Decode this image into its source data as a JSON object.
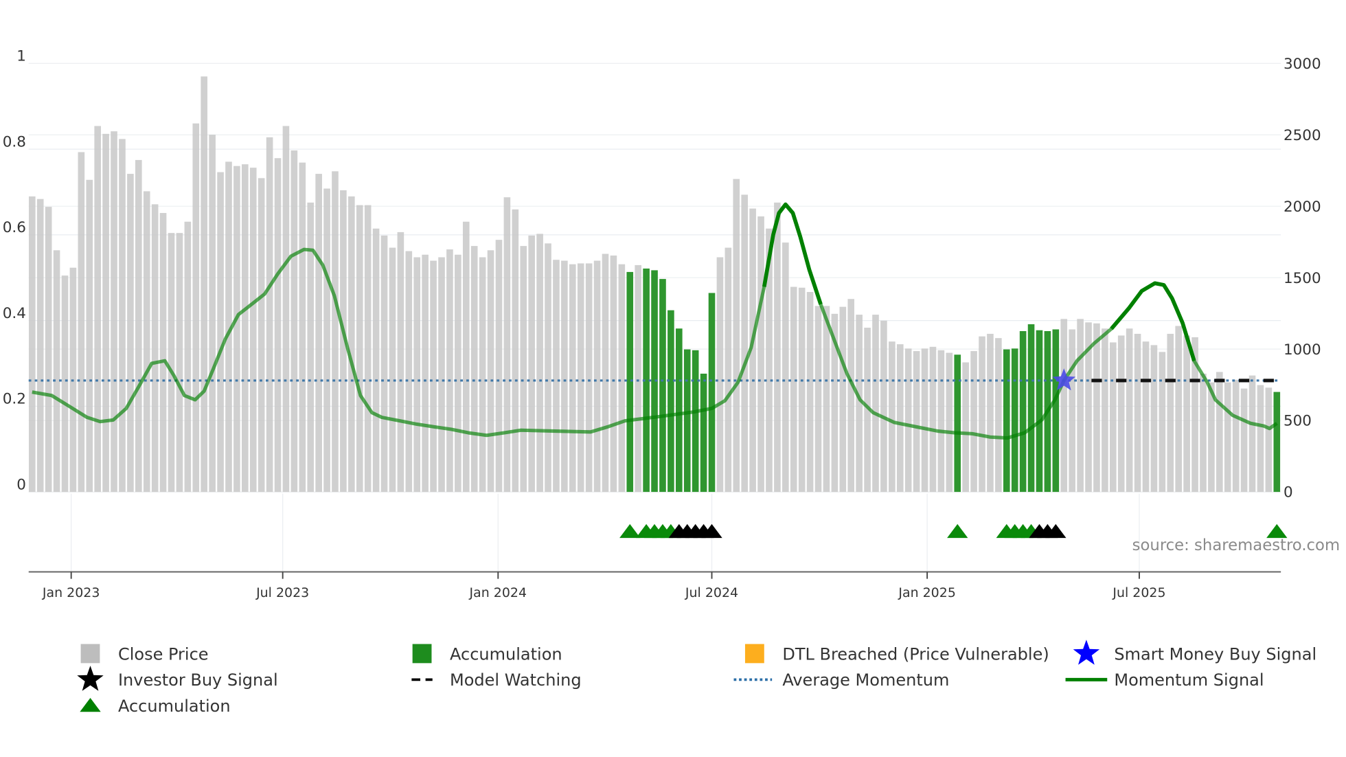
{
  "chart_data": {
    "type": "bar",
    "title": "",
    "x_unit": "week index",
    "x_ticks": [
      {
        "label": "Jan 2023",
        "at": 4.77
      },
      {
        "label": "Jul 2023",
        "at": 30.6
      },
      {
        "label": "Jan 2024",
        "at": 56.9
      },
      {
        "label": "Jul 2024",
        "at": 83.0
      },
      {
        "label": "Jan 2025",
        "at": 109.3
      },
      {
        "label": "Jul 2025",
        "at": 135.2
      }
    ],
    "left_axis": {
      "ylim": [
        0,
        1
      ],
      "ticks": [
        "0",
        "0.2",
        "0.4",
        "0.6",
        "0.8",
        "1"
      ],
      "tick_values": [
        0,
        0.2,
        0.4,
        0.6,
        0.8,
        1
      ]
    },
    "right_axis": {
      "ylim": [
        0,
        3000
      ],
      "ticks": [
        "0",
        "500",
        "1000",
        "1500",
        "2000",
        "2500",
        "3000"
      ],
      "tick_values": [
        0,
        500,
        1000,
        1500,
        2000,
        2500,
        3000
      ]
    },
    "close_price": [
      2069,
      2051,
      1996,
      1692,
      1515,
      1570,
      2379,
      2185,
      2562,
      2507,
      2525,
      2471,
      2227,
      2324,
      2105,
      2014,
      1953,
      1813,
      1813,
      1892,
      2580,
      2909,
      2501,
      2239,
      2312,
      2282,
      2294,
      2270,
      2197,
      2483,
      2337,
      2562,
      2391,
      2306,
      2026,
      2227,
      2124,
      2245,
      2112,
      2069,
      2008,
      2008,
      1844,
      1795,
      1710,
      1819,
      1686,
      1643,
      1661,
      1619,
      1643,
      1698,
      1661,
      1892,
      1722,
      1643,
      1692,
      1765,
      2063,
      1978,
      1722,
      1795,
      1807,
      1740,
      1625,
      1619,
      1594,
      1600,
      1600,
      1619,
      1667,
      1655,
      1594,
      1540,
      1588,
      1564,
      1552,
      1491,
      1272,
      1144,
      998,
      992,
      828,
      1393,
      1643,
      1710,
      2191,
      2081,
      1984,
      1929,
      1844,
      2026,
      1746,
      1436,
      1430,
      1400,
      1302,
      1302,
      1247,
      1296,
      1351,
      1241,
      1150,
      1241,
      1199,
      1053,
      1034,
      1004,
      986,
      1004,
      1016,
      992,
      974,
      961,
      907,
      986,
      1089,
      1107,
      1077,
      998,
      1004,
      1126,
      1174,
      1132,
      1126,
      1138,
      1211,
      1138,
      1211,
      1187,
      1180,
      1144,
      1047,
      1095,
      1144,
      1107,
      1053,
      1028,
      980,
      1107,
      1162,
      1095,
      1083,
      828,
      767,
      840,
      767,
      785,
      724,
      815,
      748,
      730,
      700
    ],
    "accumulation_bar_indices": [
      73,
      75,
      76,
      77,
      78,
      79,
      80,
      81,
      82,
      83,
      113,
      119,
      120,
      121,
      122,
      123,
      124,
      125,
      152
    ],
    "momentum_signal": [
      [
        0,
        0.233
      ],
      [
        2.4,
        0.225
      ],
      [
        4.6,
        0.199
      ],
      [
        6.7,
        0.174
      ],
      [
        8.3,
        0.164
      ],
      [
        9.9,
        0.168
      ],
      [
        11.5,
        0.195
      ],
      [
        13,
        0.245
      ],
      [
        14.6,
        0.3
      ],
      [
        16.2,
        0.306
      ],
      [
        17.3,
        0.272
      ],
      [
        18.6,
        0.225
      ],
      [
        19.9,
        0.215
      ],
      [
        21,
        0.235
      ],
      [
        22.1,
        0.286
      ],
      [
        23.6,
        0.357
      ],
      [
        25.2,
        0.414
      ],
      [
        26.8,
        0.438
      ],
      [
        28.4,
        0.462
      ],
      [
        30,
        0.509
      ],
      [
        31.6,
        0.55
      ],
      [
        33.2,
        0.566
      ],
      [
        34.3,
        0.564
      ],
      [
        35.5,
        0.529
      ],
      [
        36.9,
        0.458
      ],
      [
        38.5,
        0.337
      ],
      [
        40.1,
        0.225
      ],
      [
        41.5,
        0.185
      ],
      [
        42.7,
        0.174
      ],
      [
        44.9,
        0.166
      ],
      [
        47,
        0.158
      ],
      [
        49.1,
        0.152
      ],
      [
        51.2,
        0.146
      ],
      [
        53.3,
        0.138
      ],
      [
        55.5,
        0.132
      ],
      [
        57.6,
        0.138
      ],
      [
        59.7,
        0.144
      ],
      [
        63.9,
        0.142
      ],
      [
        68.2,
        0.14
      ],
      [
        70.3,
        0.152
      ],
      [
        72.4,
        0.166
      ],
      [
        76.7,
        0.176
      ],
      [
        80.9,
        0.187
      ],
      [
        83,
        0.195
      ],
      [
        84.6,
        0.213
      ],
      [
        86.2,
        0.256
      ],
      [
        87.8,
        0.337
      ],
      [
        89.4,
        0.479
      ],
      [
        90.5,
        0.6
      ],
      [
        91.2,
        0.651
      ],
      [
        92,
        0.671
      ],
      [
        92.9,
        0.651
      ],
      [
        93.8,
        0.596
      ],
      [
        94.9,
        0.519
      ],
      [
        96.3,
        0.438
      ],
      [
        97.9,
        0.357
      ],
      [
        99.5,
        0.276
      ],
      [
        101.1,
        0.215
      ],
      [
        102.7,
        0.185
      ],
      [
        105.3,
        0.162
      ],
      [
        108.5,
        0.15
      ],
      [
        110.6,
        0.142
      ],
      [
        112.7,
        0.138
      ],
      [
        114.8,
        0.136
      ],
      [
        117,
        0.128
      ],
      [
        119.1,
        0.126
      ],
      [
        121.2,
        0.138
      ],
      [
        123.3,
        0.168
      ],
      [
        124.9,
        0.215
      ],
      [
        126,
        0.26
      ],
      [
        127.6,
        0.306
      ],
      [
        129.7,
        0.347
      ],
      [
        131.8,
        0.381
      ],
      [
        133.9,
        0.428
      ],
      [
        135.5,
        0.469
      ],
      [
        137.1,
        0.487
      ],
      [
        138.2,
        0.483
      ],
      [
        139.2,
        0.452
      ],
      [
        140.5,
        0.394
      ],
      [
        141.9,
        0.306
      ],
      [
        143.5,
        0.256
      ],
      [
        144.5,
        0.215
      ],
      [
        146.6,
        0.179
      ],
      [
        148.8,
        0.16
      ],
      [
        150.4,
        0.154
      ],
      [
        151.1,
        0.148
      ],
      [
        152,
        0.16
      ]
    ],
    "momentum_active_ranges": [
      [
        89.0,
        96.6
      ],
      [
        131.5,
        142.0
      ]
    ],
    "average_momentum": 0.26,
    "accumulation_triangles": {
      "green": [
        73,
        75,
        76,
        77,
        78,
        113,
        119,
        120,
        121,
        122,
        152
      ],
      "black": [
        79,
        80,
        81,
        82,
        83,
        123,
        124,
        125
      ]
    },
    "smart_money_buy": [
      {
        "index": 126,
        "value": 0.26
      }
    ],
    "model_watching": [
      130,
      133,
      136,
      139,
      142,
      145,
      148,
      151
    ],
    "source": "source: sharemaestro.com",
    "legend": [
      {
        "label": "Close Price",
        "icon": "gray-square",
        "color": "#bdbdbd"
      },
      {
        "label": "Accumulation",
        "icon": "green-square",
        "color": "#1e8c1e"
      },
      {
        "label": "DTL Breached (Price Vulnerable)",
        "icon": "orange-square",
        "color": "#fdae1e"
      },
      {
        "label": "Smart Money Buy Signal",
        "icon": "blue-star",
        "color": "#0000ff"
      },
      {
        "label": "Investor Buy Signal",
        "icon": "black-star",
        "color": "#000000"
      },
      {
        "label": "Model Watching",
        "icon": "black-dash",
        "color": "#000000"
      },
      {
        "label": "Average Momentum",
        "icon": "blue-dotted-line",
        "color": "#2c6fa8"
      },
      {
        "label": "Momentum Signal",
        "icon": "green-line",
        "color": "#008000"
      },
      {
        "label": "Accumulation",
        "icon": "green-triangle",
        "color": "#008000"
      }
    ],
    "colors": {
      "bar": "#c8c8c8",
      "accum_bar": "#2f962f",
      "momentum": "#008000",
      "average": "#3f77a8",
      "star": "#4a4ae6"
    }
  }
}
